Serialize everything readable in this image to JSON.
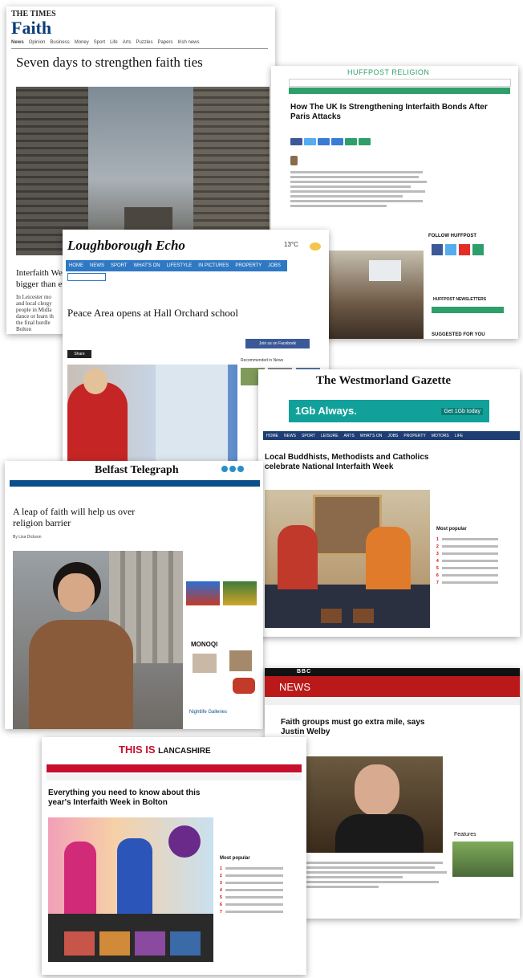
{
  "times": {
    "masthead": "THE TIMES",
    "section": "Faith",
    "nav": [
      "News",
      "Opinion",
      "Business",
      "Money",
      "Sport",
      "Life",
      "Arts",
      "Puzzles",
      "Papers",
      "Irish news"
    ],
    "headline": "Seven days to strengthen faith ties",
    "subhead": "Interfaith Wee...",
    "subhead2": "bigger than ev",
    "body": [
      "In Leicester mo",
      "and local clergy",
      "people in Midla",
      "dance or learn th",
      "the final hurdle",
      "Bolton"
    ]
  },
  "huffpost": {
    "brand": "HUFFPOST RELIGION",
    "headline": "How The UK Is Strengthening Interfaith Bonds After Paris Attacks",
    "follow": "FOLLOW HUFFPOST",
    "newsletters": "HUFFPOST NEWSLETTERS",
    "suggested": "SUGGESTED FOR YOU"
  },
  "echo": {
    "masthead": "Loughborough Echo",
    "temp": "13°C",
    "nav": [
      "HOME",
      "NEWS",
      "SPORT",
      "WHAT'S ON",
      "LIFESTYLE",
      "IN PICTURES",
      "PROPERTY",
      "JOBS"
    ],
    "headline": "Peace Area opens at Hall Orchard school",
    "share": "Share",
    "recommended": "Recommended in News",
    "facebook": "Join us on Facebook"
  },
  "westmorland": {
    "masthead": "The Westmorland Gazette",
    "ad_brand": "1Gb Always.",
    "ad_cta": "Get 1Gb today",
    "nav": [
      "HOME",
      "NEWS",
      "SPORT",
      "LEISURE",
      "ARTS",
      "WHAT'S ON",
      "JOBS",
      "PROPERTY",
      "MOTORS",
      "LIFE"
    ],
    "headline": "Local Buddhists, Methodists and Catholics celebrate National Interfaith Week",
    "most_popular": "Most popular",
    "popular_numbers": [
      "1",
      "2",
      "3",
      "4",
      "5",
      "6",
      "7"
    ]
  },
  "belfast": {
    "masthead": "Belfast Telegraph",
    "headline": "A leap of faith will help us over religion barrier",
    "byline": "By Lisa Dickson",
    "brand2": "MONOQI",
    "gallery": "Nightlife Galleries"
  },
  "bbc": {
    "logo": "BBC",
    "news": "NEWS",
    "headline": "Faith groups must go extra mile, says Justin Welby",
    "features": "Features"
  },
  "lancashire": {
    "masthead_a": "THIS IS",
    "masthead_b": "LANCASHIRE",
    "headline": "Everything you need to know about this year's Interfaith Week in Bolton",
    "most_popular": "Most popular",
    "popular_numbers": [
      "1",
      "2",
      "3",
      "4",
      "5",
      "6",
      "7"
    ]
  },
  "colors": {
    "times_blue": "#0c3c7a",
    "huff_green": "#2e9e6b",
    "echo_blue": "#2f78c4",
    "west_blue": "#1e3e73",
    "belfast_blue": "#0a4f8a",
    "bbc_red": "#bb1919",
    "lancs_red": "#c8102e"
  }
}
